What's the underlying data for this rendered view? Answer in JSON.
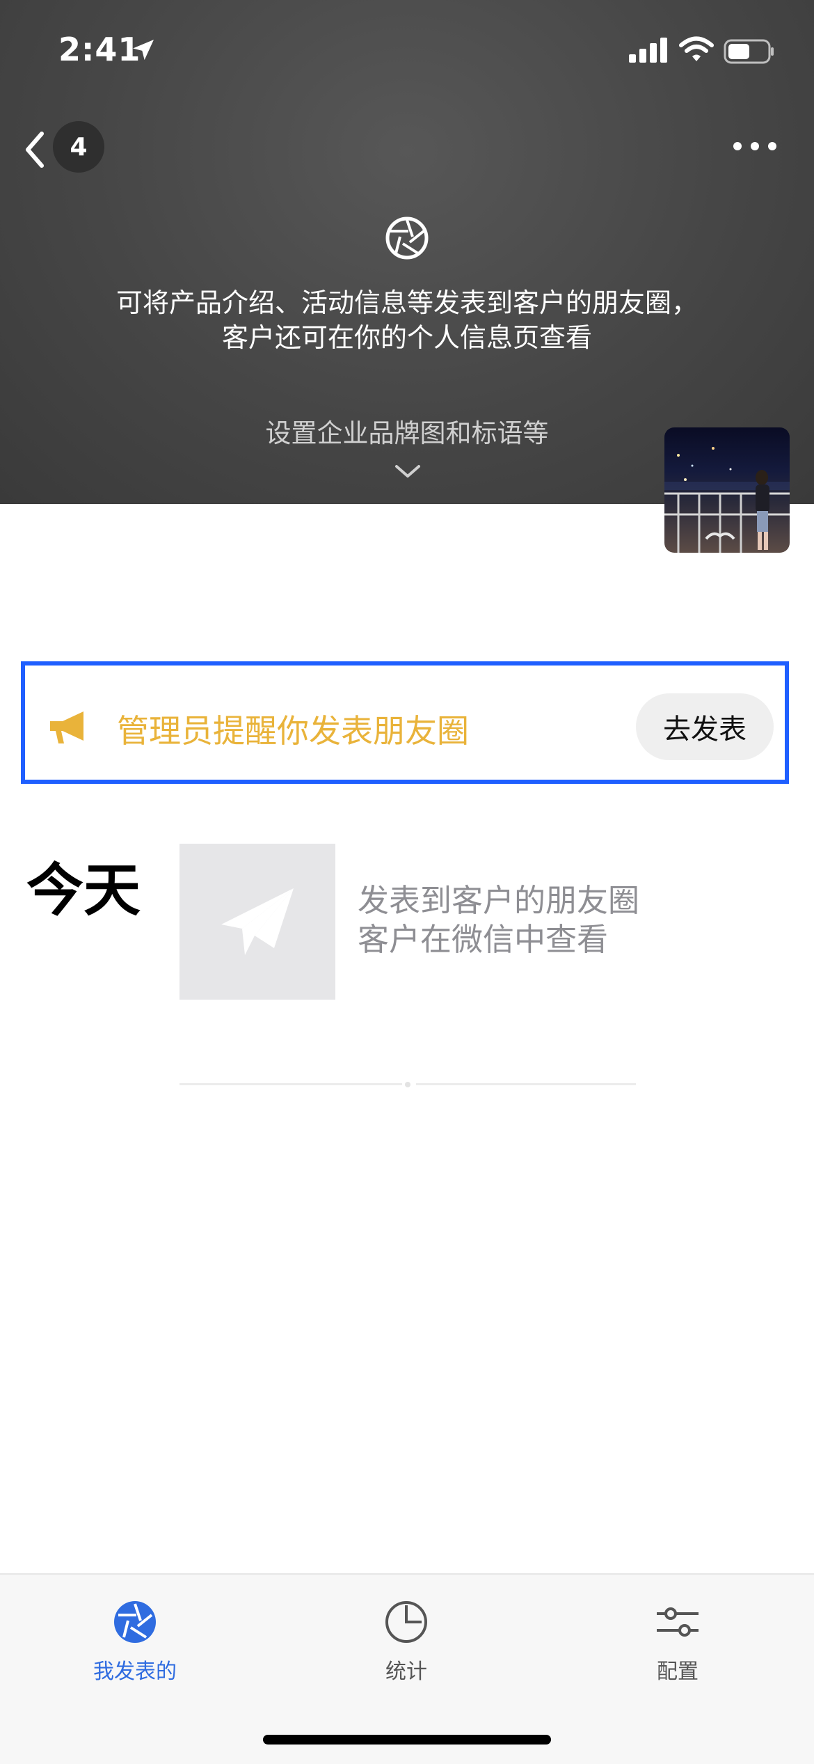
{
  "status_bar": {
    "time": "2:41"
  },
  "nav": {
    "back_count": "4"
  },
  "cover": {
    "intro_line1": "可将产品介绍、活动信息等发表到客户的朋友圈，",
    "intro_line2": "客户还可在你的个人信息页查看",
    "brand_setting": "设置企业品牌图和标语等"
  },
  "reminder": {
    "text": "管理员提醒你发表朋友圈",
    "button": "去发表"
  },
  "feed": {
    "today_label": "今天",
    "post_line1": "发表到客户的朋友圈",
    "post_line2": "客户在微信中查看"
  },
  "tabbar": {
    "tabs": [
      {
        "label": "我发表的",
        "icon": "aperture-icon",
        "active": true
      },
      {
        "label": "统计",
        "icon": "pie-chart-icon",
        "active": false
      },
      {
        "label": "配置",
        "icon": "sliders-icon",
        "active": false
      }
    ]
  },
  "colors": {
    "accent": "#2f6ce0",
    "reminder_text": "#e9b33a",
    "highlight_border": "#1f5fff"
  }
}
